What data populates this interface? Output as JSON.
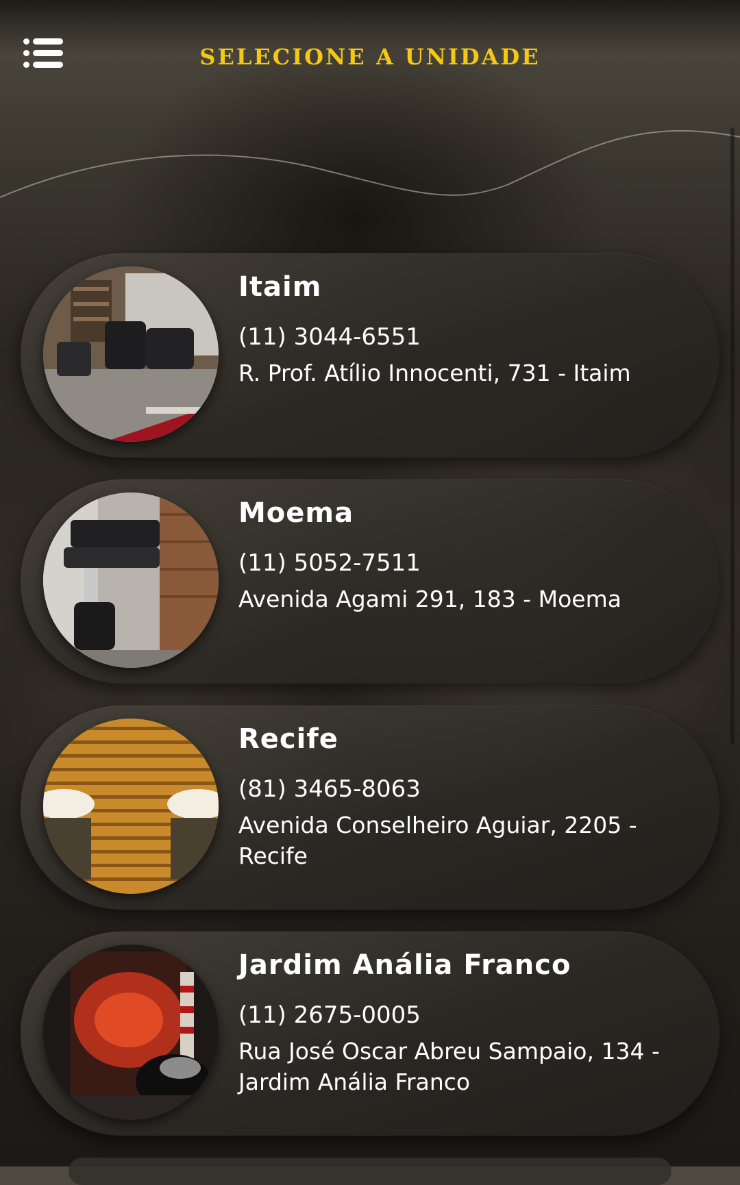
{
  "header": {
    "menu_icon": "menu-list-icon",
    "title": "SELECIONE A UNIDADE"
  },
  "colors": {
    "accent": "#f6c814",
    "card": "#3a3731",
    "text": "#ffffff"
  },
  "units": [
    {
      "name": "Itaim",
      "phone": "(11) 3044-6551",
      "address": "R. Prof. Atílio Innocenti, 731 - Itaim"
    },
    {
      "name": "Moema",
      "phone": "(11) 5052-7511",
      "address": "Avenida Agami 291, 183 - Moema"
    },
    {
      "name": "Recife",
      "phone": "(81) 3465-8063",
      "address": "Avenida Conselheiro Aguiar, 2205 - Recife"
    },
    {
      "name": "Jardim Anália Franco",
      "phone": "(11) 2675-0005",
      "address": "Rua José Oscar Abreu Sampaio, 134 - Jardim Anália Franco"
    }
  ]
}
